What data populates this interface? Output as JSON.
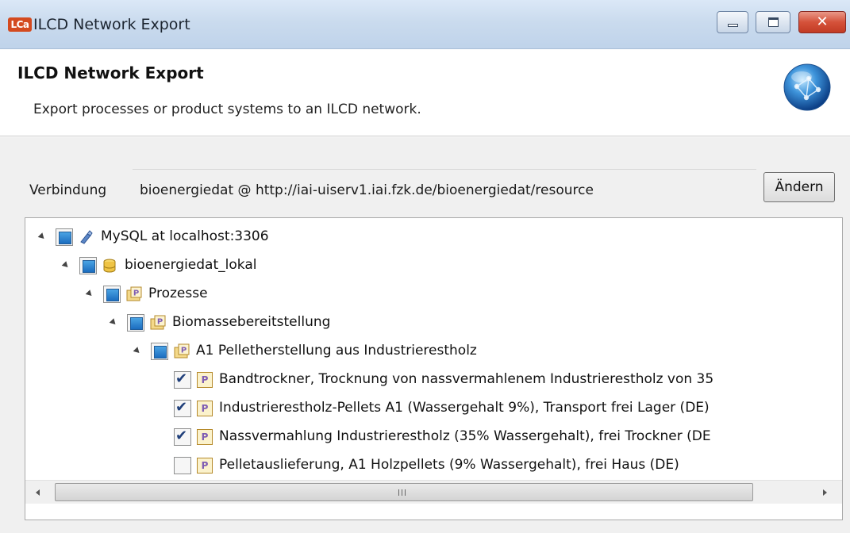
{
  "window": {
    "app_logo_text": "LCa",
    "title": "ILCD Network Export",
    "controls": {
      "minimize": "minimize-icon",
      "maximize": "maximize-icon",
      "close": "close-icon"
    }
  },
  "banner": {
    "title": "ILCD Network Export",
    "description": "Export processes or product systems to an ILCD network.",
    "icon": "globe-icon"
  },
  "connection": {
    "label": "Verbindung",
    "value": "bioenergiedat @ http://iai-uiserv1.iai.fzk.de/bioenergiedat/resource",
    "change_button": "Ändern"
  },
  "tree": {
    "nodes": [
      {
        "label": "MySQL at localhost:3306",
        "level": 0,
        "check": "partial",
        "icon": "database-connection-icon",
        "expanded": true
      },
      {
        "label": "bioenergiedat_lokal",
        "level": 1,
        "check": "partial",
        "icon": "database-icon",
        "expanded": true
      },
      {
        "label": "Prozesse",
        "level": 2,
        "check": "partial",
        "icon": "process-folder-icon",
        "expanded": true
      },
      {
        "label": "Biomassebereitstellung",
        "level": 3,
        "check": "partial",
        "icon": "process-folder-icon",
        "expanded": true
      },
      {
        "label": "A1 Pelletherstellung aus Industrierestholz",
        "level": 4,
        "check": "partial",
        "icon": "process-folder-icon",
        "expanded": true
      },
      {
        "label": "Bandtrockner, Trocknung von nassvermahlenem Industrierestholz von 35",
        "level": 5,
        "check": "checked",
        "icon": "process-icon"
      },
      {
        "label": "Industrierestholz-Pellets A1 (Wassergehalt 9%), Transport frei Lager (DE)",
        "level": 5,
        "check": "checked",
        "icon": "process-icon"
      },
      {
        "label": "Nassvermahlung Industrierestholz (35% Wassergehalt), frei Trockner (DE",
        "level": 5,
        "check": "checked",
        "icon": "process-icon"
      },
      {
        "label": "Pelletauslieferung, A1 Holzpellets (9% Wassergehalt), frei Haus (DE)",
        "level": 5,
        "check": "unchecked",
        "icon": "process-icon"
      }
    ],
    "process_icon_glyph": "P"
  },
  "colors": {
    "titlebar": "#cadbee",
    "close_button": "#d5523a",
    "partial_check": "#1b6dbf",
    "process_icon": "#7e5cb3"
  }
}
